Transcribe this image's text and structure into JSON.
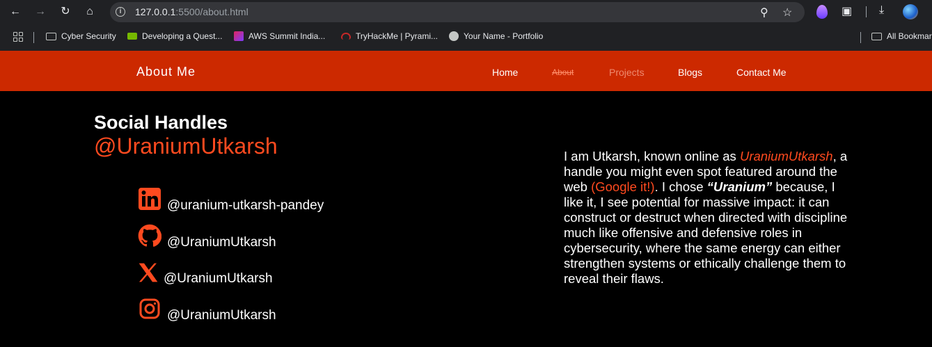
{
  "browser": {
    "url_host": "127.0.0.1",
    "url_rest": ":5500/about.html",
    "bookmarks": [
      {
        "label": "Cyber Security",
        "icon": "folder-icon"
      },
      {
        "label": "Developing a Quest...",
        "icon": "nvidia-icon"
      },
      {
        "label": "AWS Summit India...",
        "icon": "aws-icon"
      },
      {
        "label": "TryHackMe | Pyrami...",
        "icon": "tryhackme-icon"
      },
      {
        "label": "Your Name - Portfolio",
        "icon": "globe-icon"
      }
    ],
    "all_bookmarks_label": "All Bookmar"
  },
  "navbar": {
    "brand": "About Me",
    "links": [
      {
        "label": "Home",
        "state": "normal"
      },
      {
        "label": "About",
        "state": "active"
      },
      {
        "label": "Projects",
        "state": "muted"
      },
      {
        "label": "Blogs",
        "state": "normal"
      },
      {
        "label": "Contact Me",
        "state": "normal"
      }
    ]
  },
  "content": {
    "heading": "Social Handles",
    "handle": "@UraniumUtkarsh",
    "socials": [
      {
        "icon": "linkedin-icon",
        "text": "@uranium-utkarsh-pandey"
      },
      {
        "icon": "github-icon",
        "text": "@UraniumUtkarsh"
      },
      {
        "icon": "x-icon",
        "text": "@UraniumUtkarsh"
      },
      {
        "icon": "instagram-icon",
        "text": "@UraniumUtkarsh"
      }
    ],
    "bio": {
      "p1": "I am Utkarsh, known online as ",
      "handle_italic": "UraniumUtkarsh",
      "p2": ", a handle you might even spot featured around the web ",
      "google": "(Google it!)",
      "p3": ". I chose ",
      "uranium": "“Uranium”",
      "p4": " because, I like it, I see potential for massive impact: it can construct or destruct when directed with discipline much like offensive and defensive roles in cybersecurity, where the same energy can either strengthen systems or ethically challenge them to reveal their flaws."
    }
  },
  "colors": {
    "navbar_bg": "#cc2900",
    "accent": "#ff4a1f",
    "page_bg": "#000000"
  }
}
